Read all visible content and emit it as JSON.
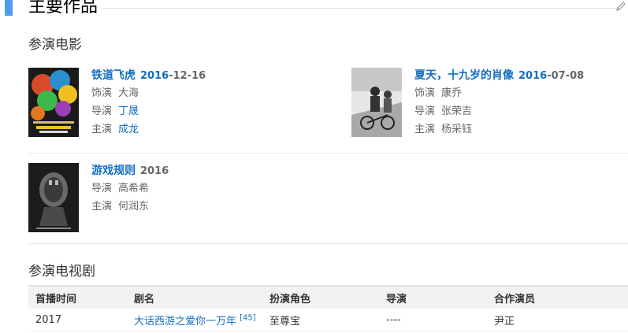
{
  "section": {
    "title": "主要作品",
    "edit_icon": "pencil-icon"
  },
  "movies_heading": "参演电影",
  "movies": [
    {
      "title": "铁道飞虎",
      "date_prefix": "2016",
      "date_suffix": "-12-16",
      "rows": [
        {
          "label": "饰演",
          "value": "大海",
          "link": false
        },
        {
          "label": "导演",
          "value": "丁晟",
          "link": true
        },
        {
          "label": "主演",
          "value": "成龙",
          "link": true
        }
      ],
      "poster_text": "RAILROAD TIGERS"
    },
    {
      "title": "夏天，十九岁的肖像",
      "date_prefix": "2016",
      "date_suffix": "-07-08",
      "rows": [
        {
          "label": "饰演",
          "value": "康乔",
          "link": false
        },
        {
          "label": "导演",
          "value": "张荣吉",
          "link": false
        },
        {
          "label": "主演",
          "value": "杨采钰",
          "link": false
        }
      ]
    },
    {
      "title": "游戏规则",
      "date_prefix": "2016",
      "date_suffix": "",
      "rows": [
        {
          "label": "导演",
          "value": "高希希",
          "link": false
        },
        {
          "label": "主演",
          "value": "何润东",
          "link": false
        }
      ]
    }
  ],
  "tv_heading": "参演电视剧",
  "tv_table": {
    "headers": [
      "首播时间",
      "剧名",
      "扮演角色",
      "导演",
      "合作演员"
    ],
    "rows": [
      {
        "year": "2017",
        "name": "大话西游之爱你一万年",
        "ref": "[45]",
        "role": "至尊宝",
        "director": "----",
        "costars": "尹正"
      }
    ]
  }
}
